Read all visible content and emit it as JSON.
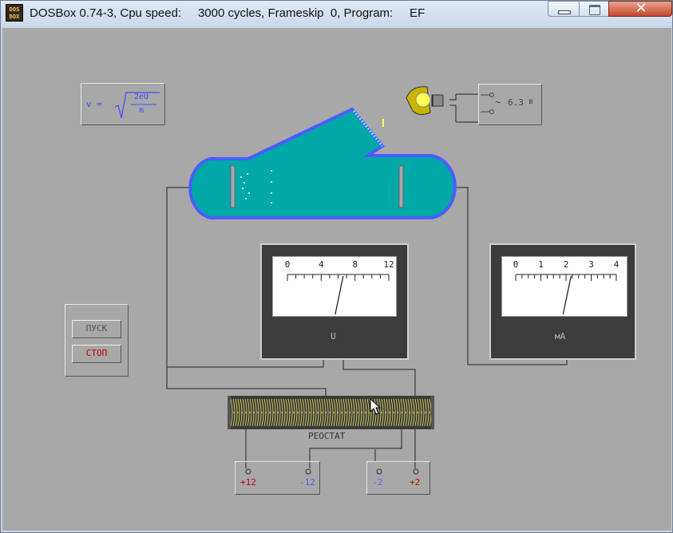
{
  "window": {
    "title": "DOSBox 0.74-3, Cpu speed:     3000 cycles, Frameskip  0, Program:     EF",
    "icon_text": "DOS BOX",
    "icons": {
      "app": "dosbox-icon",
      "minimize": "minimize-icon",
      "maximize": "maximize-icon",
      "close": "close-icon"
    },
    "close_glyph": "✕"
  },
  "formula": {
    "lhs": "v =",
    "numerator": "2eU",
    "denominator": "m"
  },
  "heater": {
    "voltage": "6.3",
    "unit": "в",
    "tilde": "~"
  },
  "voltmeter": {
    "ticks": [
      "0",
      "4",
      "8",
      "12"
    ],
    "unit": "U",
    "reading": 6.6
  },
  "ammeter": {
    "ticks": [
      "0",
      "1",
      "2",
      "3",
      "4"
    ],
    "unit": "мА",
    "reading": 2.2
  },
  "controls": {
    "start": "ПУСК",
    "stop": "СТОП"
  },
  "rheostat": {
    "label": "РЕОСТАТ"
  },
  "terminals": {
    "left": [
      {
        "label": "+12",
        "color": "#c00000"
      },
      {
        "label": "-12",
        "color": "#4a5cff"
      }
    ],
    "right": [
      {
        "label": "-2",
        "color": "#4a5cff"
      },
      {
        "label": "+2",
        "color": "#c00000"
      }
    ]
  },
  "colors": {
    "tube": "#00a8a8",
    "tube_border": "#4b5cff",
    "desktop": "#a8a8a8",
    "meter_body": "#3c3c3c"
  }
}
